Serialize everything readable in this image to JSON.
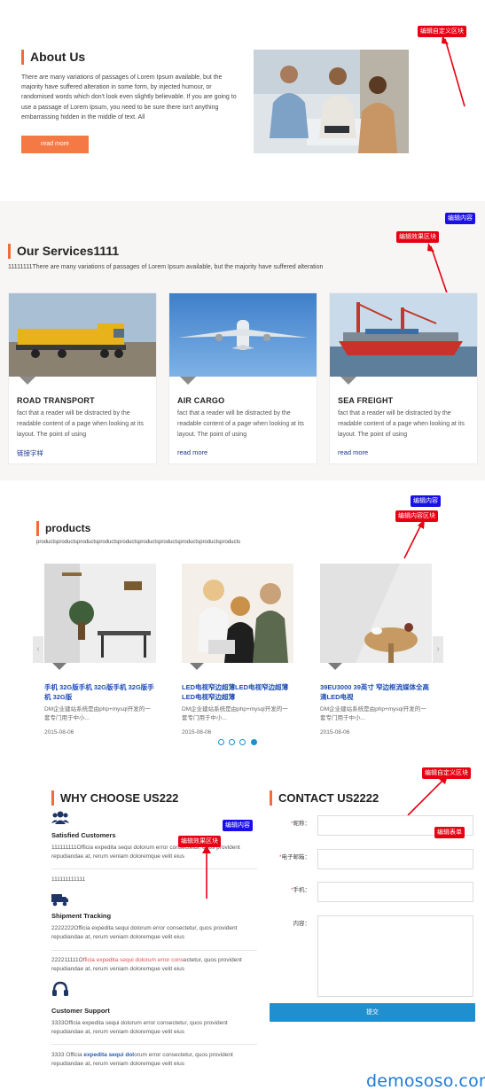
{
  "annotations": {
    "edit_custom_block": "编辑自定义区块",
    "edit_content": "编辑内容",
    "edit_effect_block": "编辑效果区块",
    "edit_content_block": "编辑内容区块",
    "edit_form": "编辑表单",
    "colors": {
      "red": "#e60012",
      "blue": "#1a0fe6"
    }
  },
  "about": {
    "title": "About Us",
    "text": "There are many variations of passages of Lorem Ipsum available, but the majority have suffered alteration in some form, by injected humour, or randomised words which don't look even slightly believable. If you are going to use a passage of Lorem Ipsum, you need to be sure there isn't anything embarrassing hidden in the middle of text. All",
    "button": "read more"
  },
  "services": {
    "title": "Our Services1111",
    "subtitle": "11111111There are many variations of passages of Lorem Ipsum available, but the majority have suffered alteration",
    "cards": [
      {
        "title": "ROAD TRANSPORT",
        "desc": "fact that a reader will be distracted by the readable content of a page when looking at its layout. The point of using",
        "link": "链接字样"
      },
      {
        "title": "AIR CARGO",
        "desc": "fact that a reader will be distracted by the readable content of a page when looking at its layout. The point of using",
        "link": "read more"
      },
      {
        "title": "SEA FREIGHT",
        "desc": "fact that a reader will be distracted by the readable content of a page when looking at its layout. The point of using",
        "link": "read more"
      }
    ]
  },
  "products": {
    "title": "products",
    "subtitle": "productsproductsproductsproductsproductsproductsproductsproductsproductsproducts",
    "items": [
      {
        "title": "手机 32G版手机 32G版手机 32G版手机 32G版",
        "desc": "DM企业建站系统是由php+mysql开发的一套专门用于中小...",
        "date": "2015-08-06"
      },
      {
        "title": "LED电视窄边超薄LED电视窄边超薄LED电视窄边超薄",
        "desc": "DM企业建站系统是由php+mysql开发的一套专门用于中小...",
        "date": "2015-08-06"
      },
      {
        "title": "39EU3000 39英寸 窄边框流媒体全高清LED电视",
        "desc": "DM企业建站系统是由php+mysql开发的一套专门用于中小...",
        "date": "2015-08-06"
      }
    ],
    "prev": "‹",
    "next": "›",
    "page_count": 4,
    "active_page": 4
  },
  "why": {
    "title": "WHY CHOOSE US222",
    "item1_title": "Satisfied Customers",
    "item1_text": "111111111Officia expedita sequi dolorum error consectetur, quos provident repudiandae at, rerum veniam doloremque velit eius",
    "item1_extra": "111111111111",
    "item2_title": "Shipment Tracking",
    "item2_text": "2222222Officia expedita sequi dolorum error consectetur, quos provident repudiandae at, rerum veniam doloremque velit eius",
    "item2_extra_a": "222211111O",
    "item2_extra_b": "fficia expedita sequi dolorum error cons",
    "item2_extra_c": "ectetur, quos provident repudiandae at, rerum veniam doloremque velit eius",
    "item3_title": "Customer Support",
    "item3_text": "3333Officia expedita sequi dolorum error consectetur, quos provident repudiandae at, rerum veniam doloremque velit eius",
    "item3_extra_a": "3333 Officia ",
    "item3_extra_b": "expedita sequi dol",
    "item3_extra_c": "orum error consectetur, quos provident repudiandae at, rerum veniam doloremque velit eius"
  },
  "contact": {
    "title": "CONTACT US2222",
    "name_label": "昵称：",
    "email_label": "电子邮箱：",
    "phone_label": "手机：",
    "content_label": "内容：",
    "required_mark": "*",
    "submit": "提交"
  },
  "watermark": "demososo.com"
}
